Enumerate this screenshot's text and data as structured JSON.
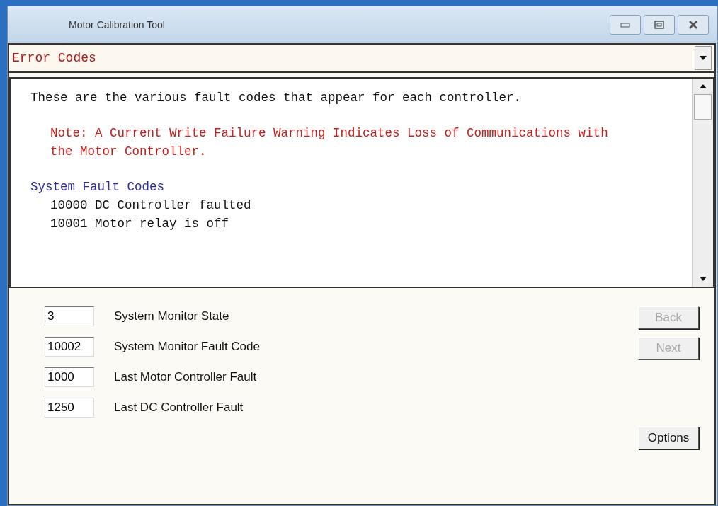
{
  "window": {
    "title": "Motor Calibration Tool"
  },
  "topic_select": {
    "value": "Error Codes"
  },
  "help_text": [
    {
      "kind": "text",
      "text": "These are the various fault codes that appear for each controller."
    },
    {
      "kind": "note",
      "text": "Note: A Current Write Failure Warning Indicates Loss of Communications with the Motor Controller."
    },
    {
      "kind": "heading",
      "text": "System Fault Codes"
    },
    {
      "kind": "item",
      "text": "10000 DC Controller faulted"
    },
    {
      "kind": "item",
      "text": "10001 Motor relay is off"
    }
  ],
  "fields": [
    {
      "value": "3",
      "label": "System Monitor State"
    },
    {
      "value": "10002",
      "label": "System Monitor Fault Code"
    },
    {
      "value": "1000",
      "label": "Last Motor Controller Fault"
    },
    {
      "value": "1250",
      "label": "Last DC Controller Fault"
    }
  ],
  "nav_buttons": [
    {
      "label": "Back",
      "disabled": true
    },
    {
      "label": "Next",
      "disabled": true
    }
  ],
  "options_button": {
    "label": "Options",
    "disabled": false
  }
}
